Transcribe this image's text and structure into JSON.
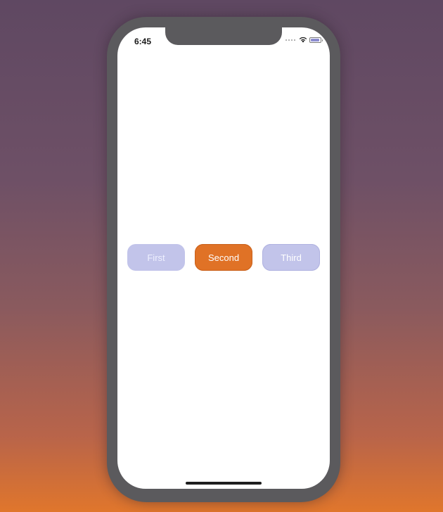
{
  "status_bar": {
    "time": "6:45",
    "icons": [
      "signal-dots-icon",
      "wifi-icon",
      "battery-icon"
    ]
  },
  "segments": {
    "first_label": "First",
    "second_label": "Second",
    "third_label": "Third",
    "selected": "Second"
  },
  "colors": {
    "selected": "#e07226",
    "unselected": "#c2c4ea"
  }
}
